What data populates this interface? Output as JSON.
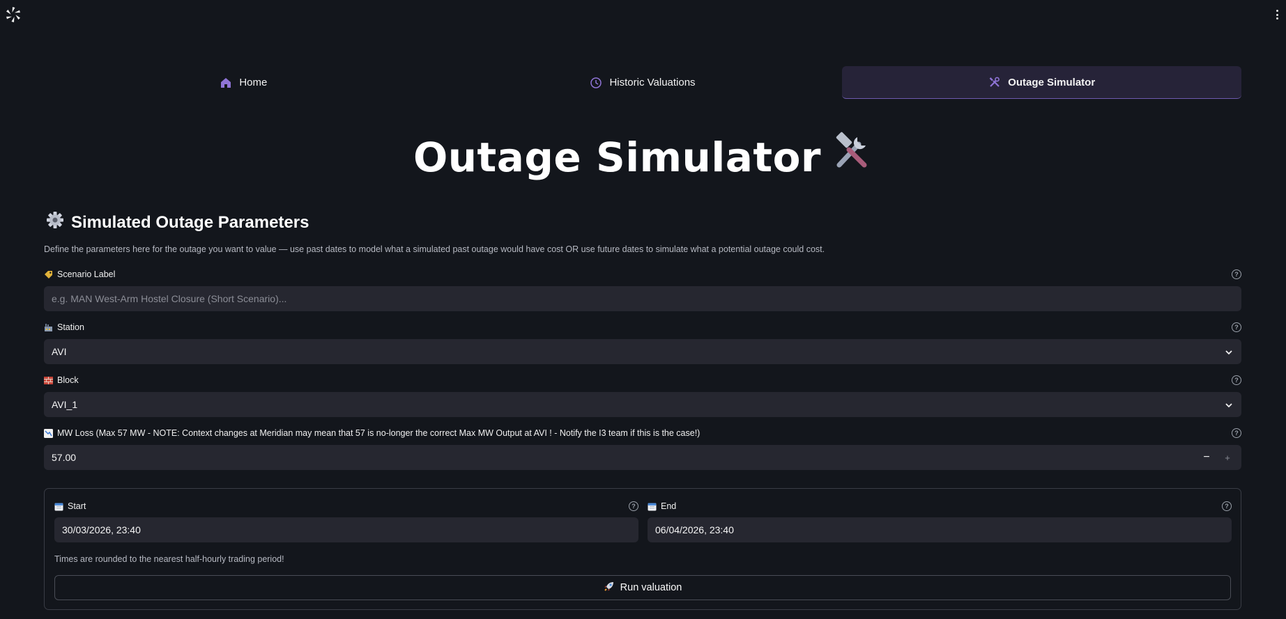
{
  "header": {
    "logo_icon": "pinwheel-logo-icon",
    "menu_icon": "kebab-menu-icon"
  },
  "nav": {
    "tabs": [
      {
        "label": "Home",
        "icon": "home-icon",
        "active": false
      },
      {
        "label": "Historic Valuations",
        "icon": "clock-icon",
        "active": false
      },
      {
        "label": "Outage Simulator",
        "icon": "tools-icon",
        "active": true
      }
    ],
    "accent_color": "#7b61c9"
  },
  "page": {
    "title": "Outage Simulator",
    "title_emoji": "hammer-and-wrench-icon"
  },
  "params": {
    "heading": "Simulated Outage Parameters",
    "heading_icon": "gear-icon",
    "description": "Define the parameters here for the outage you want to value — use past dates to model what a simulated past outage would have cost OR use future dates to simulate what a potential outage could cost."
  },
  "fields": {
    "scenario": {
      "label": "Scenario Label",
      "icon": "tag-icon",
      "placeholder": "e.g. MAN West-Arm Hostel Closure (Short Scenario)...",
      "value": ""
    },
    "station": {
      "label": "Station",
      "icon": "factory-icon",
      "value": "AVI"
    },
    "block": {
      "label": "Block",
      "icon": "brick-icon",
      "value": "AVI_1"
    },
    "mw_loss": {
      "label": "MW Loss (Max 57 MW - NOTE: Context changes at Meridian may mean that 57 is no-longer the correct Max MW Output at AVI ! - Notify the I3 team if this is the case!)",
      "icon": "chart-decreasing-icon",
      "value": "57.00",
      "minus": "−",
      "plus": "+"
    }
  },
  "dates": {
    "start": {
      "label": "Start",
      "icon": "calendar-icon",
      "value": "30/03/2026, 23:40"
    },
    "end": {
      "label": "End",
      "icon": "calendar-icon",
      "value": "06/04/2026, 23:40"
    },
    "note": "Times are rounded to the nearest half-hourly trading period!",
    "run_label": "Run valuation",
    "run_icon": "rocket-icon"
  },
  "help_glyph": "?"
}
